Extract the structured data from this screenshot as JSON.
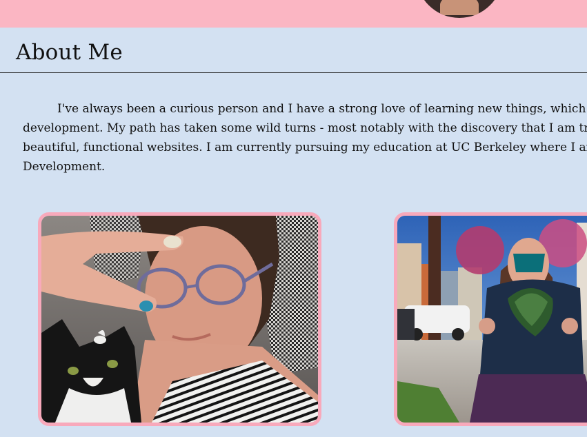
{
  "header": {
    "avatar_label": "profile-photo"
  },
  "about": {
    "title": "About Me",
    "bio": "I've always been a curious person and I have a strong love of learning new things, which is what led me to web development. My path has taken some wild turns - most notably with the discovery that I am trans - I am now on track to build beautiful, functional websites. I am currently pursuing my education at UC Berkeley where I am learning Full Stack Web Development."
  },
  "photos": [
    {
      "label": "selfie-with-cat"
    },
    {
      "label": "holding-kale-street"
    }
  ],
  "colors": {
    "banner": "#fbb6c3",
    "background": "#d3e1f2",
    "photo_border": "#f8a9bb"
  }
}
